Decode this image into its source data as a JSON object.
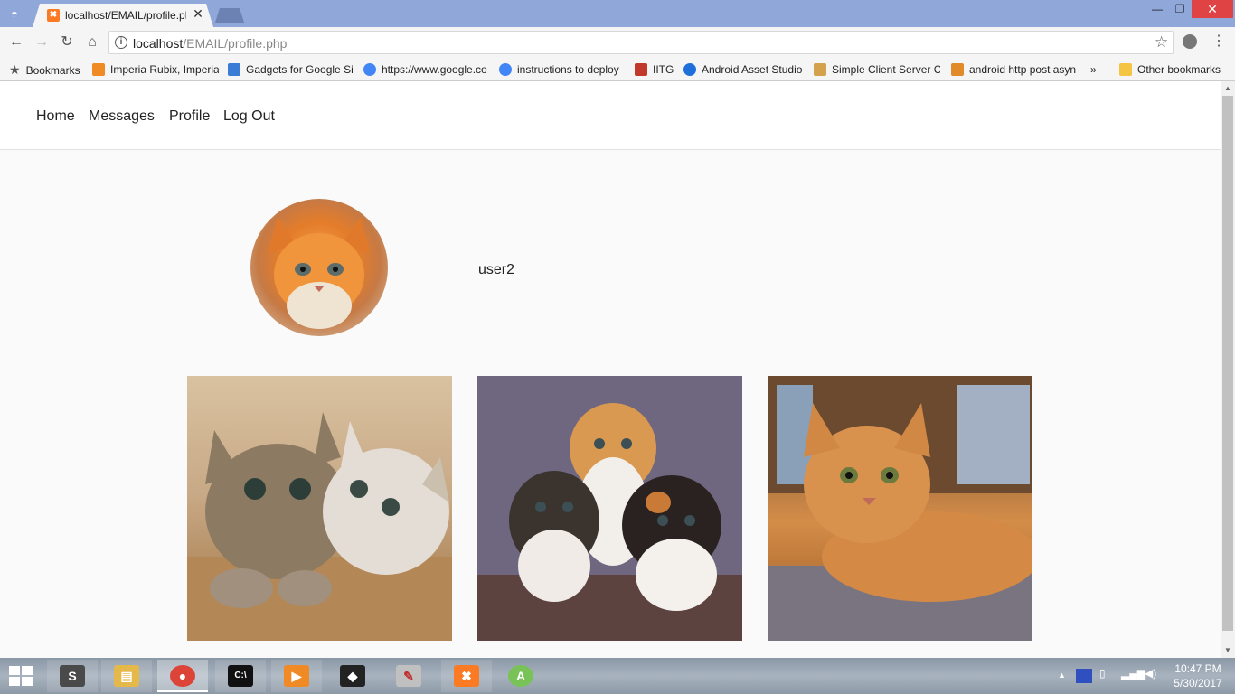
{
  "browser": {
    "tab_title": "localhost/EMAIL/profile.php",
    "tab_close": "✕",
    "url_host": "localhost",
    "url_path": "/EMAIL/profile.php",
    "window_controls": {
      "minimize": "—",
      "maximize": "❐",
      "close": "✕"
    },
    "nav_icons": {
      "back": "←",
      "forward": "→",
      "reload": "↻",
      "home": "⌂"
    },
    "star": "☆",
    "menu": "⋮"
  },
  "bookmarks": {
    "label": "Bookmarks",
    "items": [
      {
        "label": "Imperia Rubix, Imperia",
        "icon_color": "#f08a24"
      },
      {
        "label": "Gadgets for Google Si",
        "icon_color": "#3a7bd5"
      },
      {
        "label": "https://www.google.co",
        "icon_color": "#4285f4"
      },
      {
        "label": "instructions to deploy",
        "icon_color": "#4285f4"
      },
      {
        "label": "IITG",
        "icon_color": "#c0392b"
      },
      {
        "label": "Android Asset Studio",
        "icon_color": "#1e6fd9"
      },
      {
        "label": "Simple Client Server C",
        "icon_color": "#d4a24c"
      },
      {
        "label": "android http post asyn",
        "icon_color": "#e08a2a"
      }
    ],
    "overflow": "»",
    "other": "Other bookmarks"
  },
  "site": {
    "nav": [
      "Home",
      "Messages",
      "Profile",
      "Log Out"
    ],
    "username": "user2",
    "photos": [
      "photo-1",
      "photo-2",
      "photo-3"
    ]
  },
  "taskbar": {
    "apps": [
      {
        "name": "sublime-text",
        "glyph": "S",
        "color": "#4a4a4a"
      },
      {
        "name": "file-explorer",
        "glyph": "▤",
        "color": "#e5b84a"
      },
      {
        "name": "chrome",
        "glyph": "●",
        "color": "#db4437"
      },
      {
        "name": "command-prompt",
        "glyph": "C:\\",
        "color": "#111111"
      },
      {
        "name": "media-player",
        "glyph": "▶",
        "color": "#f08a24"
      },
      {
        "name": "unity",
        "glyph": "◆",
        "color": "#222222"
      },
      {
        "name": "paint",
        "glyph": "✎",
        "color": "#c0c0c0"
      },
      {
        "name": "xampp",
        "glyph": "✖",
        "color": "#fb7a24"
      },
      {
        "name": "android-studio",
        "glyph": "A",
        "color": "#78c257"
      }
    ],
    "tray_arrow": "▲",
    "time": "10:47 PM",
    "date": "5/30/2017"
  }
}
